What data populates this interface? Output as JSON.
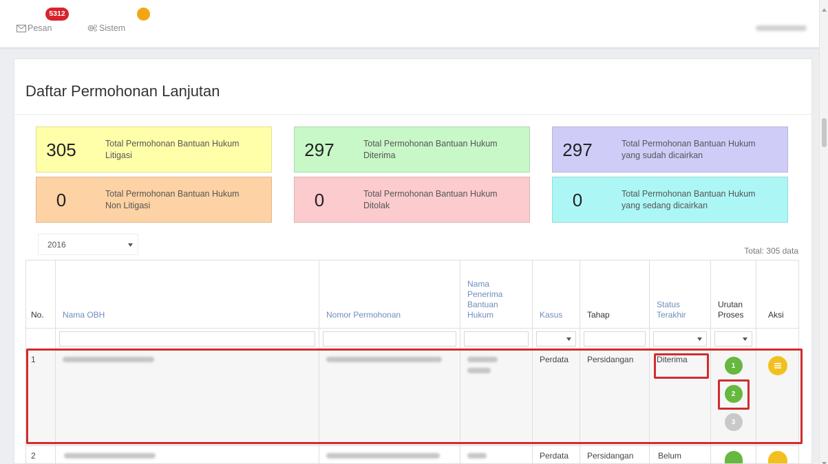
{
  "topbar": {
    "messages": {
      "label": "Pesan",
      "badge": "5312",
      "icon": "envelope-icon"
    },
    "system": {
      "label": "Sistem",
      "badge": "",
      "icon": "gears-icon"
    }
  },
  "page": {
    "title": "Daftar Permohonan Lanjutan"
  },
  "stats": [
    {
      "value": "305",
      "label": "Total Permohonan Bantuan Hukum Litigasi",
      "color": "#ffffaa"
    },
    {
      "value": "297",
      "label": "Total Permohonan Bantuan Hukum Diterima",
      "color": "#c8f7c8"
    },
    {
      "value": "297",
      "label": "Total Permohonan Bantuan Hukum yang sudah dicairkan",
      "color": "#cfcdf8"
    },
    {
      "value": "0",
      "label": "Total Permohonan Bantuan Hukum Non Litigasi",
      "color": "#fdd2a4"
    },
    {
      "value": "0",
      "label": "Total Permohonan Bantuan Hukum Ditolak",
      "color": "#fbcbcd"
    },
    {
      "value": "0",
      "label": "Total Permohonan Bantuan Hukum yang sedang dicairkan",
      "color": "#acf7f5"
    }
  ],
  "filters": {
    "year": "2016",
    "total": "Total: 305 data"
  },
  "table": {
    "headers": {
      "no": "No.",
      "nama_obh": "Nama OBH",
      "nomor": "Nomor Permohonan",
      "penerima": "Nama Penerima Bantuan Hukum",
      "kasus": "Kasus",
      "tahap": "Tahap",
      "status": "Status Terakhir",
      "urutan": "Urutan Proses",
      "aksi": "Aksi"
    },
    "rows": [
      {
        "no": "1",
        "kasus": "Perdata",
        "tahap": "Persidangan",
        "status": "Diterima",
        "steps": [
          {
            "label": "1",
            "state": "done"
          },
          {
            "label": "2",
            "state": "done"
          },
          {
            "label": "3",
            "state": "pending"
          }
        ],
        "action_icon": "list-icon"
      },
      {
        "no": "2",
        "kasus": "Perdata",
        "tahap": "Persidangan",
        "status": "Belum",
        "steps": [
          {
            "label": "",
            "state": "done"
          }
        ],
        "action_icon": "list-icon"
      }
    ]
  },
  "colors": {
    "badge_messages": "#d7232c",
    "badge_system": "#f2a712",
    "header_link": "#6e8dbd",
    "step_done": "#66b83f",
    "step_pending": "#c9c9c9",
    "action": "#f2c01e",
    "annotation": "#d12b2e"
  }
}
